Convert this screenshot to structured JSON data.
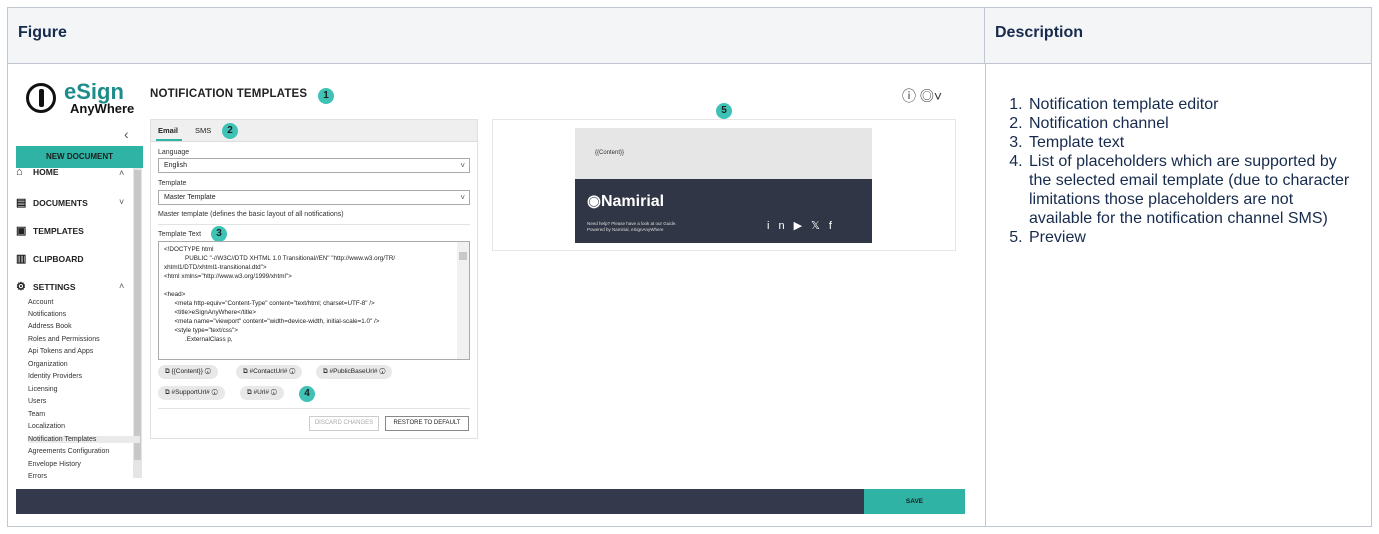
{
  "table": {
    "figure_header": "Figure",
    "description_header": "Description",
    "description_items": [
      "Notification template editor",
      "Notification channel",
      "Template text",
      "List of placeholders which are supported by the selected email template (due to character limitations those placeholders are not available for the notification channel SMS)",
      "Preview"
    ]
  },
  "app": {
    "logo_primary": "eSign",
    "logo_secondary": "AnyWhere",
    "new_document": "NEW DOCUMENT",
    "nav": {
      "home": "HOME",
      "documents": "DOCUMENTS",
      "templates": "TEMPLATES",
      "clipboard": "CLIPBOARD",
      "settings": "SETTINGS"
    },
    "settings_items": [
      "Account",
      "Notifications",
      "Address Book",
      "Roles and Permissions",
      "Api Tokens and Apps",
      "Organization",
      "Identity Providers",
      "Licensing",
      "Users",
      "Team",
      "Localization",
      "Notification Templates",
      "Agreements Configuration",
      "Envelope History",
      "Errors"
    ],
    "page_title": "NOTIFICATION TEMPLATES",
    "badges": [
      "1",
      "2",
      "3",
      "4",
      "5"
    ],
    "tabs": {
      "email": "Email",
      "sms": "SMS"
    },
    "language_label": "Language",
    "language_value": "English",
    "template_label": "Template",
    "template_value": "Master Template",
    "template_desc": "Master template (defines the basic layout of all notifications)",
    "template_text_label": "Template Text",
    "code_text": "<!DOCTYPE html\n            PUBLIC \"-//W3C//DTD XHTML 1.0 Transitional//EN\" \"http://www.w3.org/TR/\nxhtml1/DTD/xhtml1-transitional.dtd\">\n<html xmlns=\"http://www.w3.org/1999/xhtml\">\n\n<head>\n      <meta http-equiv=\"Content-Type\" content=\"text/html; charset=UTF-8\" />\n      <title>eSignAnyWhere</title>\n      <meta name=\"viewport\" content=\"width=device-width, initial-scale=1.0\" />\n      <style type=\"text/css\">\n            .ExternalClass p,",
    "placeholders": [
      "{{Content}}",
      "#ContactUrl#",
      "#PublicBaseUrl#",
      "#SupportUrl#",
      "#Url#"
    ],
    "discard_label": "DISCARD CHANGES",
    "restore_label": "RESTORE TO DEFAULT",
    "save_label": "SAVE",
    "preview": {
      "content_placeholder": "{{Content}}",
      "brand": "Namirial",
      "help_line1": "Need help? Please have a look at our Guide.",
      "help_line2": "Powered by Namirial, eSignAnyWhere"
    }
  },
  "colors": {
    "accent": "#2fb3a4",
    "dark_bar": "#343a4b",
    "badge": "#3fc2b6"
  }
}
